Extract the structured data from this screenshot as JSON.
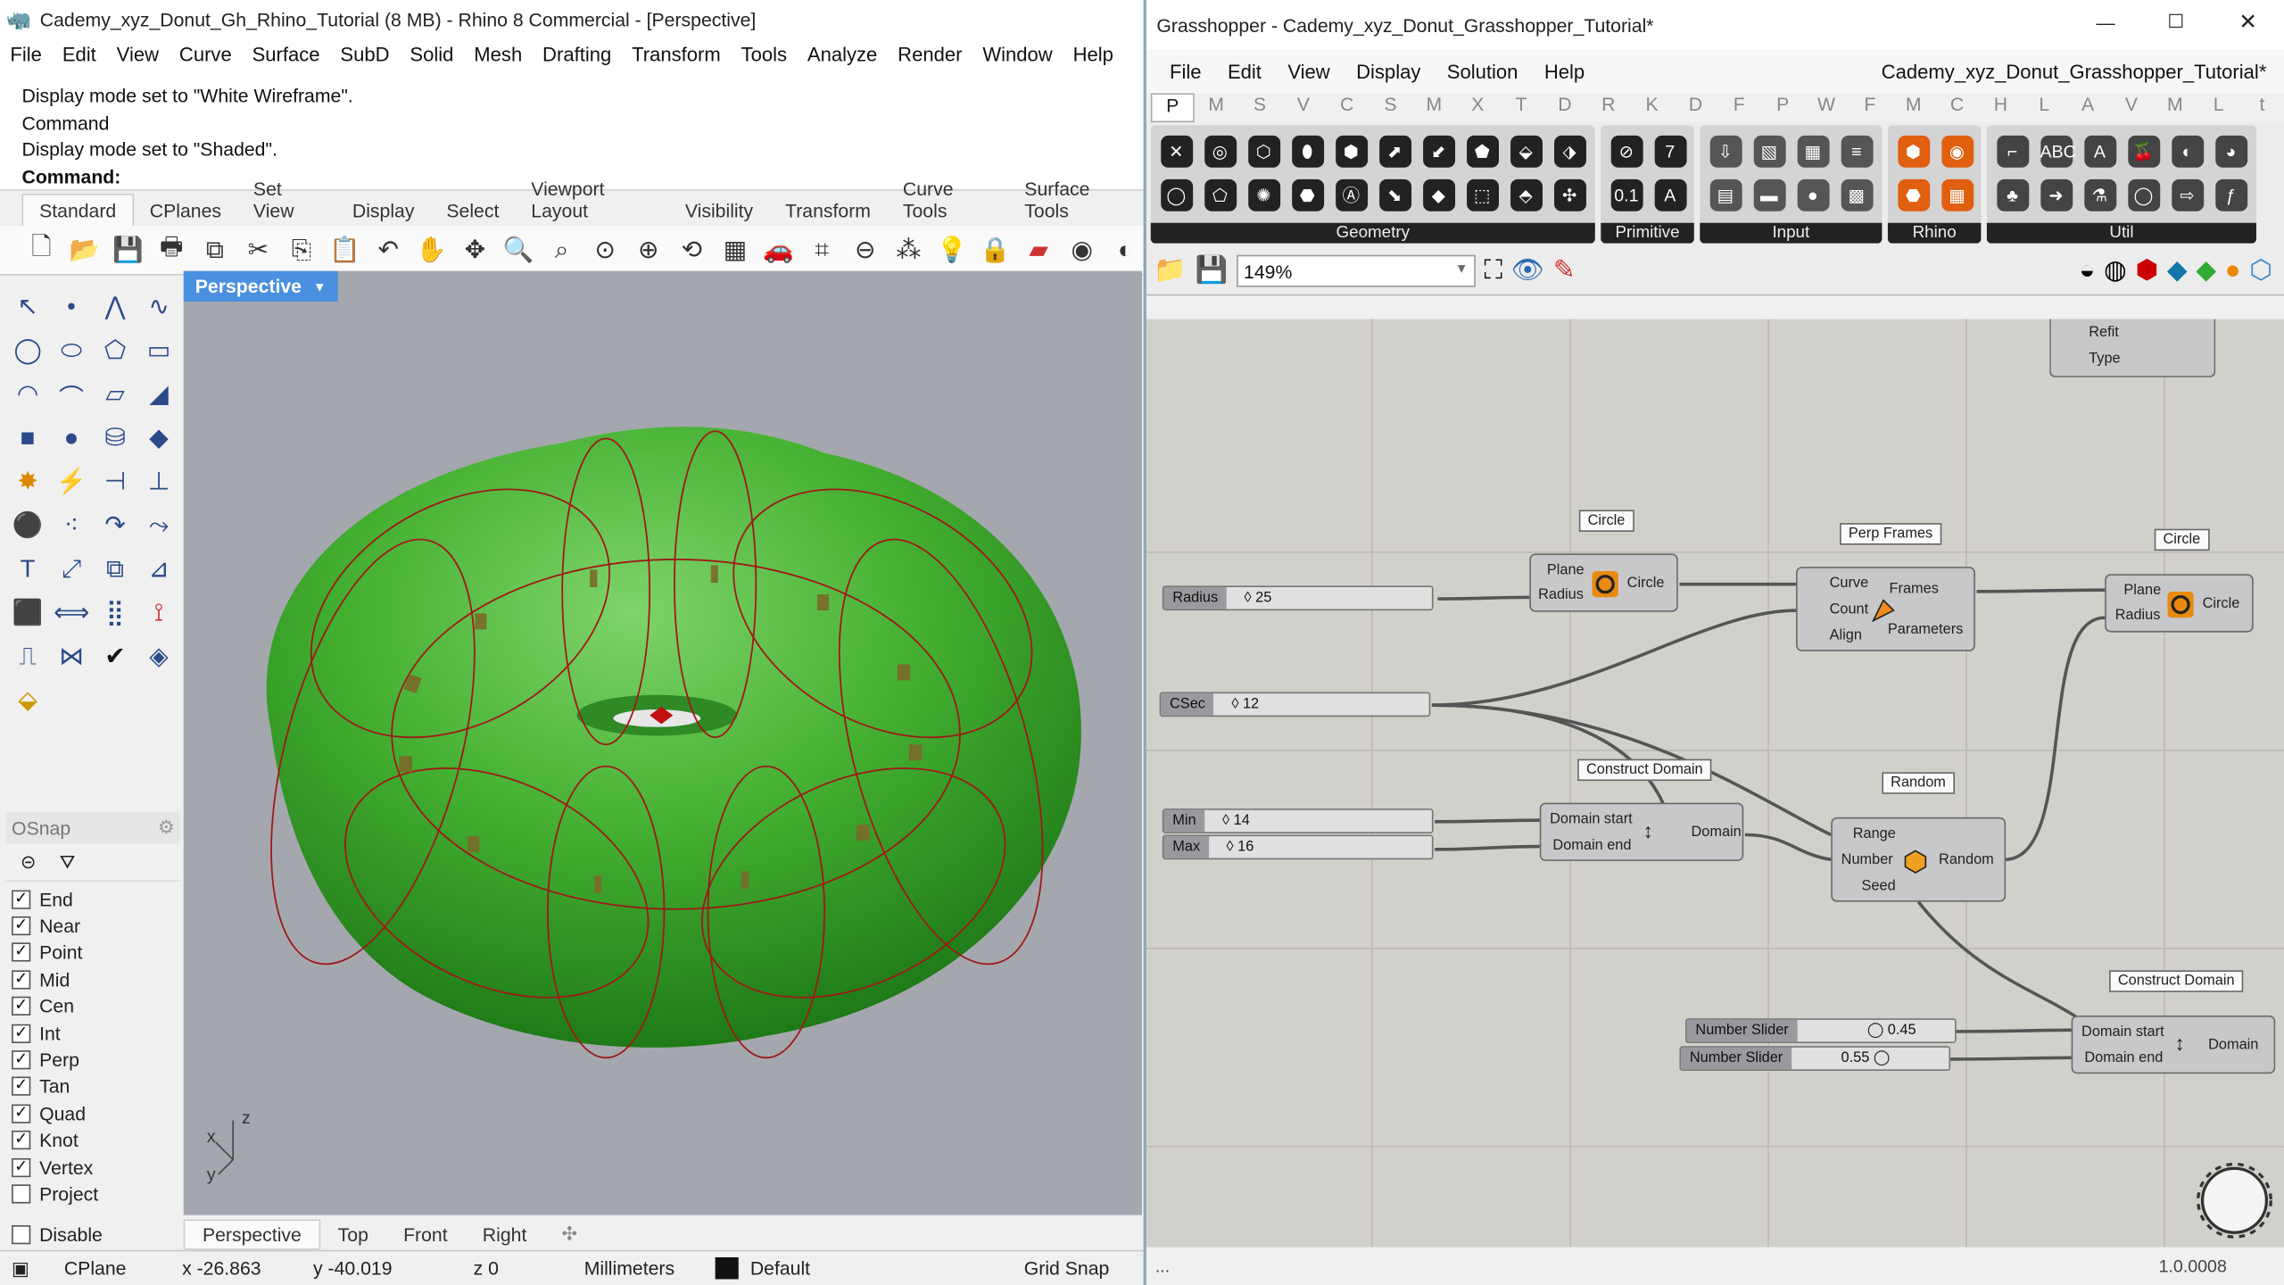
{
  "rhino": {
    "title": "Cademy_xyz_Donut_Gh_Rhino_Tutorial (8 MB) - Rhino 8 Commercial - [Perspective]",
    "menu": [
      "File",
      "Edit",
      "View",
      "Curve",
      "Surface",
      "SubD",
      "Solid",
      "Mesh",
      "Drafting",
      "Transform",
      "Tools",
      "Analyze",
      "Render",
      "Window",
      "Help"
    ],
    "history": [
      "Display mode set to \"White Wireframe\".",
      "Command",
      "Display mode set to \"Shaded\"."
    ],
    "command_prompt": "Command:",
    "toolbar_tabs": [
      "Standard",
      "CPlanes",
      "Set View",
      "Display",
      "Select",
      "Viewport Layout",
      "Visibility",
      "Transform",
      "Curve Tools",
      "Surface Tools"
    ],
    "viewport_label": "Perspective",
    "osnap": {
      "title": "OSnap",
      "items": [
        {
          "label": "End",
          "checked": true
        },
        {
          "label": "Near",
          "checked": true
        },
        {
          "label": "Point",
          "checked": true
        },
        {
          "label": "Mid",
          "checked": true
        },
        {
          "label": "Cen",
          "checked": true
        },
        {
          "label": "Int",
          "checked": true
        },
        {
          "label": "Perp",
          "checked": true
        },
        {
          "label": "Tan",
          "checked": true
        },
        {
          "label": "Quad",
          "checked": true
        },
        {
          "label": "Knot",
          "checked": true
        },
        {
          "label": "Vertex",
          "checked": true
        },
        {
          "label": "Project",
          "checked": false
        }
      ],
      "disable": "Disable"
    },
    "viewport_tabs": [
      "Perspective",
      "Top",
      "Front",
      "Right"
    ],
    "axis": {
      "z": "z",
      "x": "x",
      "y": "y"
    },
    "status": {
      "cplane": "CPlane",
      "x": "x -26.863",
      "y": "y -40.019",
      "z": "z 0",
      "units": "Millimeters",
      "layer": "Default",
      "snap": "Grid Snap"
    }
  },
  "grasshopper": {
    "title": "Grasshopper - Cademy_xyz_Donut_Grasshopper_Tutorial*",
    "menu": [
      "File",
      "Edit",
      "View",
      "Display",
      "Solution",
      "Help"
    ],
    "doc_name": "Cademy_xyz_Donut_Grasshopper_Tutorial*",
    "categories": [
      "P",
      "M",
      "S",
      "V",
      "C",
      "S",
      "M",
      "X",
      "T",
      "D",
      "R",
      "K",
      "D",
      "F",
      "P",
      "W",
      "F",
      "M",
      "C",
      "H",
      "L",
      "A",
      "V",
      "M",
      "L",
      "t"
    ],
    "groups": [
      "Geometry",
      "Primitive",
      "Input",
      "Rhino",
      "Util"
    ],
    "zoom": "149%",
    "version": "1.0.0008",
    "status_left": "...",
    "nodes": {
      "top_partial": {
        "ports": [
          "Refit",
          "Type"
        ]
      },
      "circle1": {
        "tag": "Circle",
        "inputs": [
          "Plane",
          "Radius"
        ],
        "output": "Circle"
      },
      "perp": {
        "tag": "Perp Frames",
        "inputs": [
          "Curve",
          "Count",
          "Align"
        ],
        "outputs": [
          "Frames",
          "Parameters"
        ]
      },
      "circle2": {
        "tag": "Circle",
        "inputs": [
          "Plane",
          "Radius"
        ],
        "output": "Circle"
      },
      "cdomain1": {
        "tag": "Construct Domain",
        "inputs": [
          "Domain start",
          "Domain end"
        ],
        "output": "Domain"
      },
      "random": {
        "tag": "Random",
        "inputs": [
          "Range",
          "Number",
          "Seed"
        ],
        "output": "Random"
      },
      "cdomain2": {
        "tag": "Construct Domain",
        "inputs": [
          "Domain start",
          "Domain end"
        ],
        "output": "Domain"
      }
    },
    "sliders": [
      {
        "name": "Radius",
        "value": "25"
      },
      {
        "name": "CSec",
        "value": "12"
      },
      {
        "name": "Min",
        "value": "14"
      },
      {
        "name": "Max",
        "value": "16"
      },
      {
        "name": "Number Slider",
        "value": "0.45"
      },
      {
        "name": "Number Slider",
        "value": "0.55"
      }
    ]
  }
}
